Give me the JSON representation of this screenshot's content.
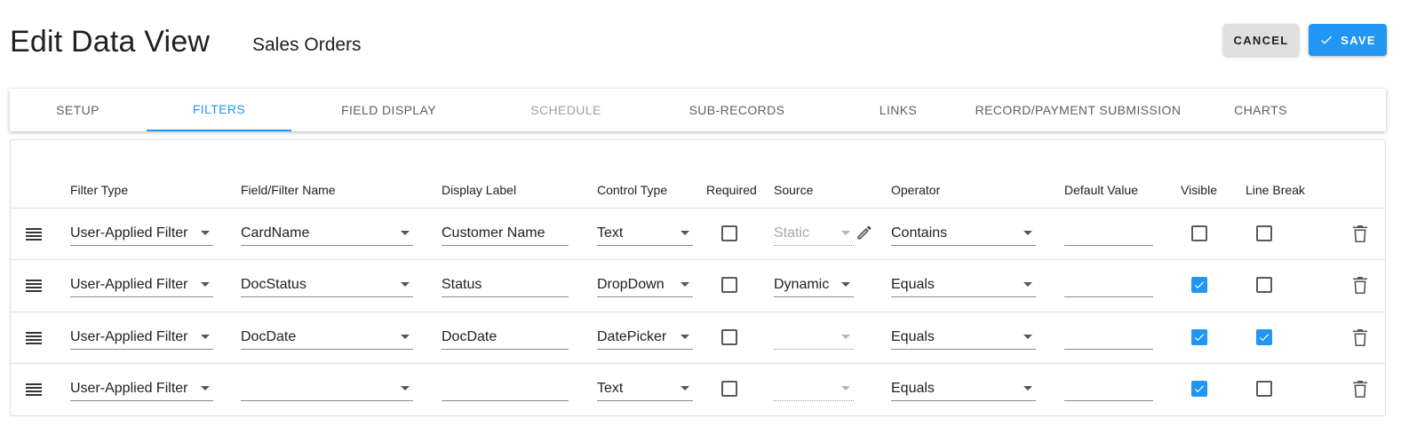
{
  "header": {
    "title": "Edit Data View",
    "subtitle": "Sales Orders",
    "cancel_label": "CANCEL",
    "save_label": "SAVE"
  },
  "tabs": [
    {
      "label": "SETUP",
      "state": "normal"
    },
    {
      "label": "FILTERS",
      "state": "active"
    },
    {
      "label": "FIELD DISPLAY",
      "state": "normal"
    },
    {
      "label": "SCHEDULE",
      "state": "disabled"
    },
    {
      "label": "SUB-RECORDS",
      "state": "normal"
    },
    {
      "label": "LINKS",
      "state": "normal"
    },
    {
      "label": "RECORD/PAYMENT SUBMISSION",
      "state": "normal"
    },
    {
      "label": "CHARTS",
      "state": "normal"
    }
  ],
  "columns": {
    "filter_type": "Filter Type",
    "field_name": "Field/Filter Name",
    "display_label": "Display Label",
    "control_type": "Control Type",
    "required": "Required",
    "source": "Source",
    "operator": "Operator",
    "default_value": "Default Value",
    "visible": "Visible",
    "line_break": "Line Break"
  },
  "rows": [
    {
      "filter_type": "User-Applied Filter",
      "field_name": "CardName",
      "display_label": "Customer Name",
      "control_type": "Text",
      "required": false,
      "source": "Static",
      "source_disabled": true,
      "operator": "Contains",
      "default_value": "",
      "visible": false,
      "line_break": false
    },
    {
      "filter_type": "User-Applied Filter",
      "field_name": "DocStatus",
      "display_label": "Status",
      "control_type": "DropDown",
      "required": false,
      "source": "Dynamic",
      "source_disabled": false,
      "operator": "Equals",
      "default_value": "",
      "visible": true,
      "line_break": false
    },
    {
      "filter_type": "User-Applied Filter",
      "field_name": "DocDate",
      "display_label": "DocDate",
      "control_type": "DatePicker",
      "required": false,
      "source": "",
      "source_disabled": true,
      "operator": "Equals",
      "default_value": "",
      "visible": true,
      "line_break": true
    },
    {
      "filter_type": "User-Applied Filter",
      "field_name": "",
      "display_label": "",
      "control_type": "Text",
      "required": false,
      "source": "",
      "source_disabled": true,
      "operator": "Equals",
      "default_value": "",
      "visible": true,
      "line_break": false
    }
  ],
  "colors": {
    "accent": "#2196f3",
    "cancel_bg": "#e0e0e0"
  },
  "icons": {
    "save": "check-icon",
    "drag": "drag-handle-icon",
    "edit": "pencil-icon",
    "delete": "trash-icon",
    "dropdown": "caret-down-icon"
  }
}
